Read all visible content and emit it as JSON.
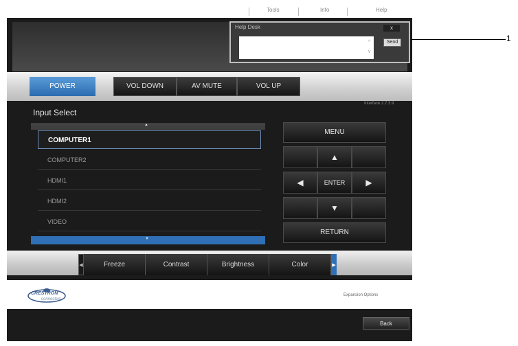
{
  "topbar": {
    "tools": "Tools",
    "info": "Info",
    "help": "Help"
  },
  "helpdesk": {
    "title": "Help Desk",
    "close_label": "x",
    "send_label": "Send",
    "scroll_up": "^",
    "scroll_down": "v",
    "message_value": ""
  },
  "callout": {
    "number": "1"
  },
  "controls": {
    "power": "POWER",
    "vol_down": "VOL DOWN",
    "av_mute": "AV MUTE",
    "vol_up": "VOL UP"
  },
  "version": "Interface 2.7.3.9",
  "input_select": {
    "title": "Input Select",
    "up_arrow": "▲",
    "down_arrow": "▼",
    "items": [
      {
        "label": "COMPUTER1",
        "selected": true
      },
      {
        "label": "COMPUTER2",
        "selected": false
      },
      {
        "label": "HDMI1",
        "selected": false
      },
      {
        "label": "HDMI2",
        "selected": false
      },
      {
        "label": "VIDEO",
        "selected": false
      }
    ]
  },
  "nav": {
    "menu": "MENU",
    "up": "▲",
    "left": "◀",
    "enter": "ENTER",
    "right": "▶",
    "down": "▼",
    "return": "RETURN"
  },
  "adjust": {
    "left_cap": "◀",
    "right_cap": "▶",
    "items": [
      "Freeze",
      "Contrast",
      "Brightness",
      "Color"
    ]
  },
  "footer": {
    "logo_text": "CRESTRON",
    "logo_sub": "connected",
    "expansion": "Expansion Options"
  },
  "back_label": "Back",
  "colors": {
    "accent_blue": "#2f6fb5",
    "power_blue": "#4a8ccc",
    "frame": "#1b1b1b"
  }
}
